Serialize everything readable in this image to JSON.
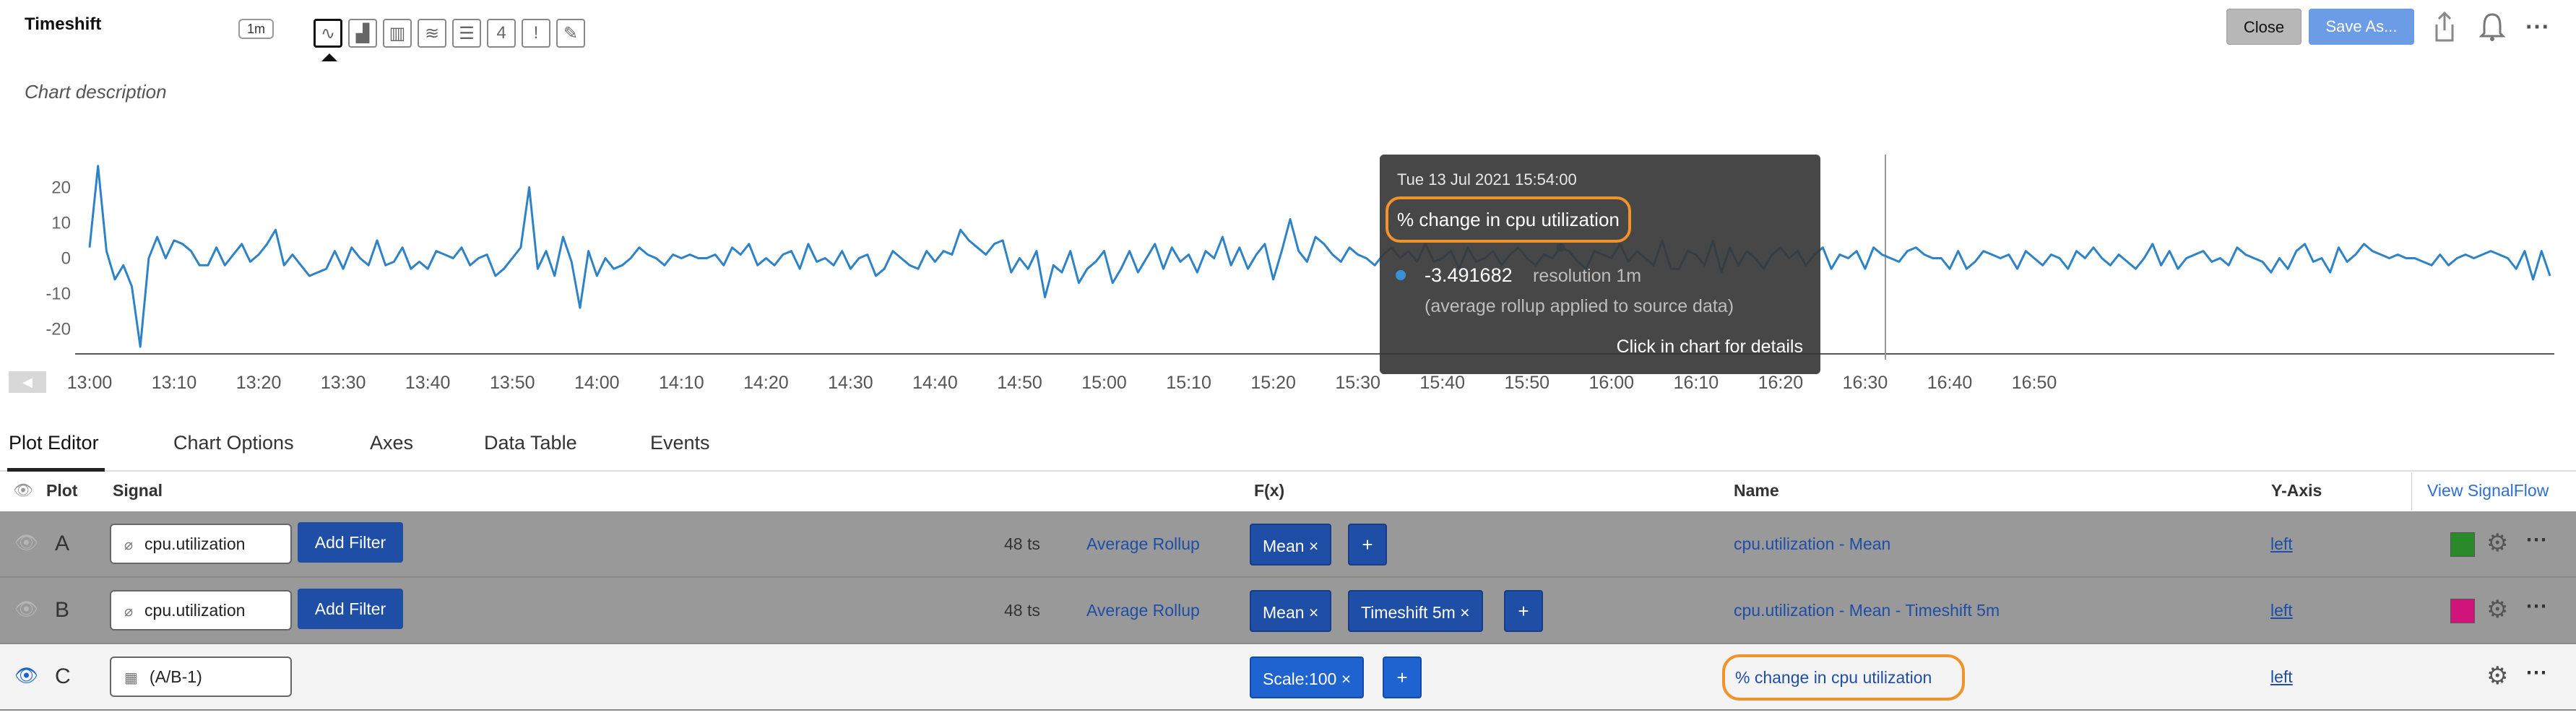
{
  "header": {
    "title": "Timeshift",
    "resolution": "1m",
    "chart_types": [
      {
        "name": "line",
        "glyph": "∿"
      },
      {
        "name": "area",
        "glyph": "▟"
      },
      {
        "name": "column",
        "glyph": "▥"
      },
      {
        "name": "heatmap",
        "glyph": "≋"
      },
      {
        "name": "list",
        "glyph": "☰"
      },
      {
        "name": "single-value",
        "glyph": "4"
      },
      {
        "name": "event-feed",
        "glyph": "!"
      },
      {
        "name": "text",
        "glyph": "✎"
      }
    ],
    "close_label": "Close",
    "save_label": "Save As...",
    "description": "Chart description"
  },
  "chart_data": {
    "type": "line",
    "x_start": "13:00",
    "x_step_minutes": 1,
    "x_ticks": [
      "13:00",
      "13:10",
      "13:20",
      "13:30",
      "13:40",
      "13:50",
      "14:00",
      "14:10",
      "14:20",
      "14:30",
      "14:40",
      "14:50",
      "15:00",
      "15:10",
      "15:20",
      "15:30",
      "15:40",
      "15:50",
      "16:00",
      "16:10",
      "16:20",
      "16:30",
      "16:40",
      "16:50"
    ],
    "y_ticks": [
      20,
      10,
      0,
      -10,
      -20
    ],
    "ylim": [
      -27,
      28
    ],
    "color": "#2e83c6",
    "values": [
      3,
      26,
      2,
      -6,
      -2,
      -8,
      -25,
      0,
      6,
      0,
      5,
      4,
      2,
      -2,
      -2,
      3,
      -2,
      1,
      4,
      -1,
      1,
      4,
      8,
      -2,
      1,
      -2,
      -5,
      -4,
      -3,
      2,
      -3,
      3,
      0,
      -2,
      5,
      -2,
      -1,
      3,
      -3,
      -1,
      -3,
      2,
      1,
      0,
      3,
      -2,
      0,
      1,
      -5,
      -3,
      0,
      3,
      20,
      -3,
      2,
      -5,
      6,
      -1,
      -14,
      2,
      -5,
      0,
      -3,
      -2,
      0,
      3,
      1,
      0,
      -2,
      1,
      0,
      1,
      0,
      0,
      1,
      -2,
      3,
      1,
      4,
      -2,
      0,
      -2,
      1,
      2,
      -3,
      4,
      -1,
      0,
      -2,
      2,
      -3,
      0,
      1,
      -5,
      -3,
      2,
      0,
      -2,
      -3,
      2,
      -1,
      2,
      1,
      8,
      5,
      3,
      1,
      4,
      5,
      -4,
      0,
      -3,
      2,
      -11,
      -2,
      -4,
      2,
      -7,
      -3,
      -1,
      2,
      -7,
      -3,
      2,
      -4,
      0,
      4,
      -3,
      3,
      -1,
      1,
      -4,
      2,
      0,
      6,
      -2,
      3,
      -3,
      1,
      4,
      -6,
      2,
      11,
      2,
      -1,
      6,
      4,
      1,
      -1,
      3,
      1,
      0,
      -2,
      1,
      3,
      0,
      2,
      -1,
      4,
      -1,
      0,
      2,
      -3,
      3,
      -1,
      0,
      2,
      -2,
      1,
      3,
      0,
      -2,
      1,
      0,
      3,
      2,
      -1,
      -3,
      2,
      1,
      0,
      4,
      -1,
      2,
      0,
      -2,
      5,
      -3,
      -3,
      2,
      1,
      -2,
      5,
      -4,
      3,
      -2,
      2,
      0,
      -3,
      1,
      3,
      0,
      2,
      -2,
      1,
      3,
      -3,
      1,
      0,
      2,
      -3,
      3,
      1,
      0,
      -1,
      2,
      3,
      1,
      0,
      0,
      -3,
      2,
      -3,
      -1,
      2,
      1,
      0,
      1,
      -3,
      2,
      0,
      -2,
      1,
      0,
      -3,
      2,
      0,
      3,
      0,
      -2,
      1,
      -1,
      -3,
      0,
      4,
      -2,
      2,
      -3,
      0,
      1,
      2,
      -1,
      0,
      -2,
      3,
      1,
      0,
      -1,
      -4,
      0,
      -3,
      2,
      4,
      -1,
      0,
      -4,
      3,
      -1,
      1,
      4,
      2,
      1,
      0,
      1,
      0,
      0,
      -1,
      -2,
      1,
      -2,
      0,
      1,
      0,
      1,
      2,
      1,
      0,
      -3,
      2,
      -6,
      2,
      -5
    ],
    "hover_index": 174
  },
  "tooltip": {
    "date": "Tue 13 Jul 2021 15:54:00",
    "signal_name": "% change in cpu utilization",
    "value": "-3.491682",
    "resolution_text": "resolution 1m",
    "note": "(average rollup applied to source data)",
    "hint": "Click in chart for details"
  },
  "tabs": [
    "Plot Editor",
    "Chart Options",
    "Axes",
    "Data Table",
    "Events"
  ],
  "table": {
    "headers": {
      "plot": "Plot",
      "signal": "Signal",
      "fx": "F(x)",
      "name": "Name",
      "yaxis": "Y-Axis",
      "view_link": "View SignalFlow"
    },
    "rows": [
      {
        "letter": "A",
        "signal": "cpu.utilization",
        "filter_label": "Add Filter",
        "ts": "48 ts",
        "rollup": "Average Rollup",
        "functions": [
          "Mean ×"
        ],
        "name": "cpu.utilization - Mean",
        "axis": "left",
        "color": "#2a8a2a"
      },
      {
        "letter": "B",
        "signal": "cpu.utilization",
        "filter_label": "Add Filter",
        "ts": "48 ts",
        "rollup": "Average Rollup",
        "functions": [
          "Mean ×",
          "Timeshift 5m ×"
        ],
        "name": "cpu.utilization - Mean - Timeshift 5m",
        "axis": "left",
        "color": "#d0147a"
      },
      {
        "letter": "C",
        "signal": "(A/B-1)",
        "functions": [
          "Scale:100 ×"
        ],
        "name": "% change in cpu utilization",
        "axis": "left"
      }
    ],
    "plus_label": "+"
  }
}
